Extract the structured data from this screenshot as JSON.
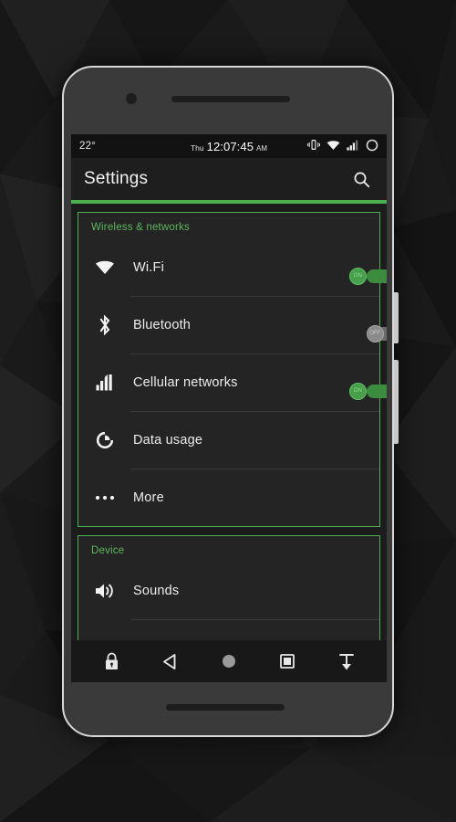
{
  "device": {
    "name": "android-phone-mockup",
    "camera_icon": "camera-dot",
    "earpiece_icon": "earpiece-speaker",
    "bottom_speaker_icon": "bottom-speaker",
    "side_buttons": [
      "power-button",
      "volume-button"
    ]
  },
  "status_bar": {
    "temperature": "22°",
    "day_of_week": "Thu",
    "time": "12:07:45",
    "meridiem": "AM",
    "icons": [
      "vibrate-icon",
      "wifi-icon",
      "cellular-signal-icon",
      "battery-icon"
    ]
  },
  "action_bar": {
    "title": "Settings",
    "search_icon": "search-icon"
  },
  "theme": {
    "accent": "#4caf50",
    "section_header_color": "#5cb85c",
    "screen_background": "#1c1c1c",
    "card_background": "#242424",
    "toggle_on_track": "#3c8c40",
    "toggle_on_knob": "#46a04a",
    "toggle_off_track": "#6b6b6b",
    "toggle_off_knob": "#8a8a8a"
  },
  "sections": [
    {
      "title": "Wireless & networks",
      "rows": [
        {
          "label": "Wi.Fi",
          "icon": "wifi-icon",
          "toggle": "on",
          "toggle_label": "ON"
        },
        {
          "label": "Bluetooth",
          "icon": "bluetooth-icon",
          "toggle": "off",
          "toggle_label": "OFF"
        },
        {
          "label": "Cellular networks",
          "icon": "cellular-signal-icon",
          "toggle": "on",
          "toggle_label": "ON"
        },
        {
          "label": "Data usage",
          "icon": "data-usage-icon",
          "toggle": "none"
        },
        {
          "label": "More",
          "icon": "more-dots-icon",
          "toggle": "none"
        }
      ]
    },
    {
      "title": "Device",
      "rows": [
        {
          "label": "Sounds",
          "icon": "volume-icon",
          "toggle": "none"
        }
      ]
    }
  ],
  "nav_bar": {
    "buttons": [
      {
        "name": "lock-icon"
      },
      {
        "name": "back-icon"
      },
      {
        "name": "home-icon"
      },
      {
        "name": "recents-icon"
      },
      {
        "name": "hide-keyboard-icon"
      }
    ]
  }
}
